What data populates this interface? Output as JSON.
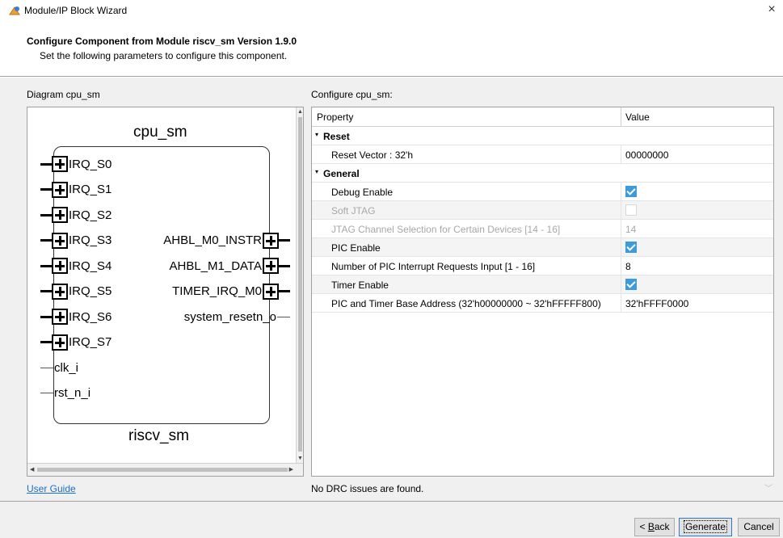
{
  "window": {
    "title": "Module/IP Block Wizard",
    "icon": "wizard-app-icon",
    "close_glyph": "×"
  },
  "header": {
    "title": "Configure Component from Module riscv_sm Version 1.9.0",
    "subtitle": "Set the following parameters to configure this component."
  },
  "diagram": {
    "label": "Diagram cpu_sm",
    "instance_name": "cpu_sm",
    "module_name": "riscv_sm",
    "left_pins": [
      {
        "name": "IRQ_S0",
        "bus": true
      },
      {
        "name": "IRQ_S1",
        "bus": true
      },
      {
        "name": "IRQ_S2",
        "bus": true
      },
      {
        "name": "IRQ_S3",
        "bus": true
      },
      {
        "name": "IRQ_S4",
        "bus": true
      },
      {
        "name": "IRQ_S5",
        "bus": true
      },
      {
        "name": "IRQ_S6",
        "bus": true
      },
      {
        "name": "IRQ_S7",
        "bus": true
      },
      {
        "name": "clk_i",
        "bus": false
      },
      {
        "name": "rst_n_i",
        "bus": false
      }
    ],
    "right_pins": [
      {
        "name": "AHBL_M0_INSTR",
        "bus": true
      },
      {
        "name": "AHBL_M1_DATA",
        "bus": true
      },
      {
        "name": "TIMER_IRQ_M0",
        "bus": true
      },
      {
        "name": "system_resetn_o",
        "bus": false
      }
    ]
  },
  "config": {
    "label": "Configure cpu_sm:",
    "columns": {
      "property": "Property",
      "value": "Value"
    },
    "rows": [
      {
        "type": "group",
        "label": "Reset"
      },
      {
        "type": "text",
        "label": "Reset Vector : 32'h",
        "value": "00000000",
        "disabled": false
      },
      {
        "type": "group",
        "label": "General"
      },
      {
        "type": "check",
        "label": "Debug Enable",
        "checked": true,
        "disabled": false
      },
      {
        "type": "check",
        "label": "Soft JTAG",
        "checked": false,
        "disabled": true
      },
      {
        "type": "text",
        "label": "JTAG Channel Selection for Certain Devices  [14 - 16]",
        "value": "14",
        "disabled": true
      },
      {
        "type": "check",
        "label": "PIC Enable",
        "checked": true,
        "disabled": false
      },
      {
        "type": "text",
        "label": "Number of PIC Interrupt Requests Input  [1 - 16]",
        "value": "8",
        "disabled": false
      },
      {
        "type": "check",
        "label": "Timer Enable",
        "checked": true,
        "disabled": false
      },
      {
        "type": "text",
        "label": "PIC and Timer Base Address (32'h00000000 ~ 32'hFFFFF800)",
        "value": "32'hFFFF0000",
        "disabled": false
      }
    ]
  },
  "links": {
    "user_guide": "User Guide"
  },
  "status": {
    "drc": "No DRC issues are found."
  },
  "buttons": {
    "back_prefix": "< ",
    "back_mnemonic": "B",
    "back_rest": "ack",
    "generate": "Generate",
    "cancel": "Cancel"
  },
  "colors": {
    "checkbox_on": "#3c9bd8",
    "link": "#1a6fc9",
    "disabled_text": "#a8a8a8"
  }
}
